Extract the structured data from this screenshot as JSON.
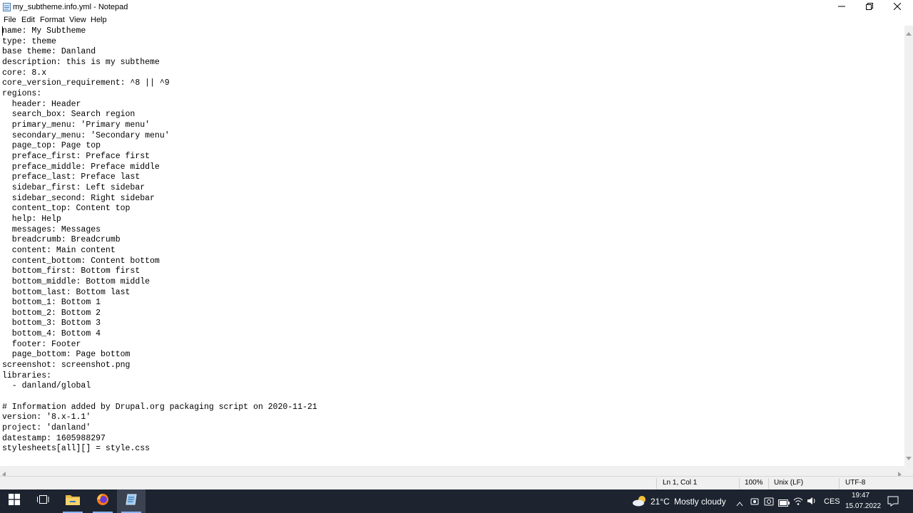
{
  "window": {
    "title": "my_subtheme.info.yml - Notepad",
    "app_icon": "notepad-icon",
    "controls": [
      "minimize-icon",
      "restore-icon",
      "close-icon"
    ]
  },
  "menu": [
    "File",
    "Edit",
    "Format",
    "View",
    "Help"
  ],
  "editor": {
    "lines": [
      "name: My Subtheme",
      "type: theme",
      "base theme: Danland",
      "description: this is my subtheme",
      "core: 8.x",
      "core_version_requirement: ^8 || ^9",
      "regions:",
      "  header: Header",
      "  search_box: Search region",
      "  primary_menu: 'Primary menu'",
      "  secondary_menu: 'Secondary menu'",
      "  page_top: Page top",
      "  preface_first: Preface first",
      "  preface_middle: Preface middle",
      "  preface_last: Preface last",
      "  sidebar_first: Left sidebar",
      "  sidebar_second: Right sidebar",
      "  content_top: Content top",
      "  help: Help",
      "  messages: Messages",
      "  breadcrumb: Breadcrumb",
      "  content: Main content",
      "  content_bottom: Content bottom",
      "  bottom_first: Bottom first",
      "  bottom_middle: Bottom middle",
      "  bottom_last: Bottom last",
      "  bottom_1: Bottom 1",
      "  bottom_2: Bottom 2",
      "  bottom_3: Bottom 3",
      "  bottom_4: Bottom 4",
      "  footer: Footer",
      "  page_bottom: Page bottom",
      "screenshot: screenshot.png",
      "libraries:",
      "  - danland/global",
      "",
      "# Information added by Drupal.org packaging script on 2020-11-21",
      "version: '8.x-1.1'",
      "project: 'danland'",
      "datestamp: 1605988297",
      "stylesheets[all][] = style.css"
    ]
  },
  "status": {
    "position": "Ln 1, Col 1",
    "zoom": "100%",
    "line_ending": "Unix (LF)",
    "encoding": "UTF-8"
  },
  "taskbar": {
    "icons": [
      "windows-start-icon",
      "task-view-icon",
      "file-explorer-icon",
      "firefox-icon",
      "notepad-icon"
    ],
    "active": "notepad-icon",
    "weather": {
      "icon": "partly-cloudy-icon",
      "temp": "21°C",
      "text": "Mostly cloudy"
    },
    "tray_icons": [
      "chevron-up-icon",
      "meet-now-icon",
      "webcam-icon",
      "battery-icon",
      "wifi-icon",
      "speaker-icon"
    ],
    "language": "CES",
    "time": "19:47",
    "date": "15.07.2022",
    "notification_icon": "notification-icon"
  }
}
